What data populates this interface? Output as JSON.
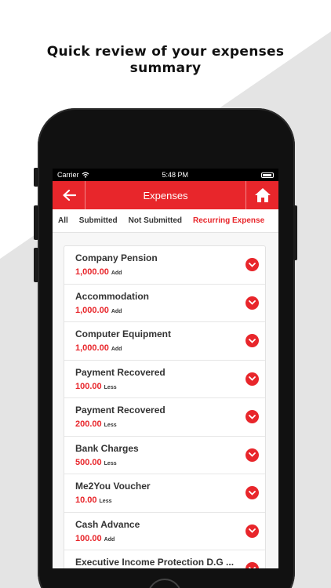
{
  "headline": {
    "line1": "Quick review of your expenses",
    "line2": "summary"
  },
  "status_bar": {
    "carrier": "Carrier",
    "time": "5:48 PM"
  },
  "header": {
    "title": "Expenses",
    "back_icon": "arrow-left-icon",
    "home_icon": "home-icon",
    "accent_color": "#e8262b"
  },
  "tabs": [
    {
      "label": "All"
    },
    {
      "label": "Submitted"
    },
    {
      "label": "Not Submitted"
    },
    {
      "label": "Recurring Expense"
    }
  ],
  "expenses": [
    {
      "title": "Company Pension",
      "amount": "1,000.00",
      "type": "Add"
    },
    {
      "title": "Accommodation",
      "amount": "1,000.00",
      "type": "Add"
    },
    {
      "title": "Computer Equipment",
      "amount": "1,000.00",
      "type": "Add"
    },
    {
      "title": "Payment Recovered",
      "amount": "100.00",
      "type": "Less"
    },
    {
      "title": "Payment Recovered",
      "amount": "200.00",
      "type": "Less"
    },
    {
      "title": "Bank Charges",
      "amount": "500.00",
      "type": "Less"
    },
    {
      "title": "Me2You Voucher",
      "amount": "10.00",
      "type": "Less"
    },
    {
      "title": "Cash Advance",
      "amount": "100.00",
      "type": "Add"
    },
    {
      "title": "Executive Income Protection D.G ...",
      "amount": "",
      "type": ""
    }
  ]
}
